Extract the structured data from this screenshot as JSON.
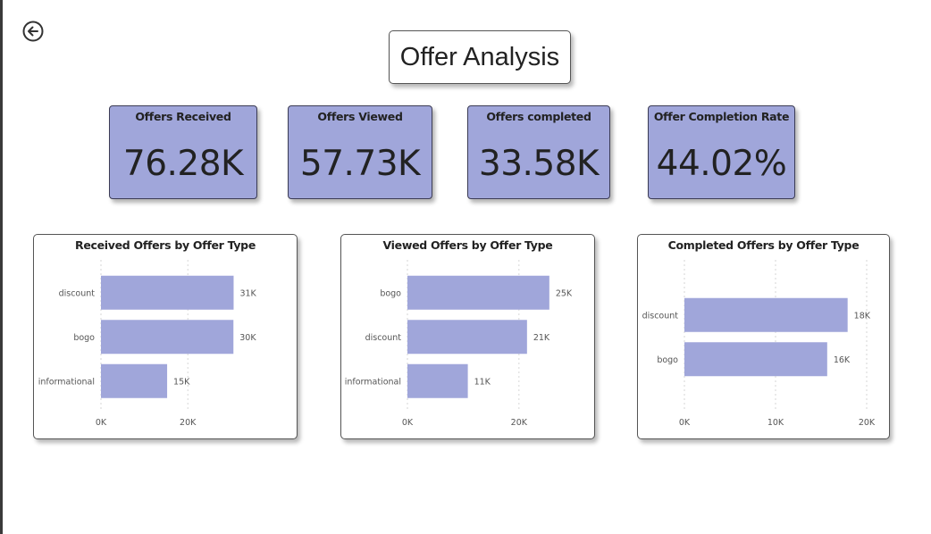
{
  "page": {
    "title": "Offer Analysis",
    "back_icon": "back-arrow-icon",
    "accent_color": "#a0a6da"
  },
  "cards": [
    {
      "label": "Offers Received",
      "value": "76.28K"
    },
    {
      "label": "Offers Viewed",
      "value": "57.73K"
    },
    {
      "label": "Offers completed",
      "value": "33.58K"
    },
    {
      "label": "Offer Completion Rate",
      "value": "44.02%"
    }
  ],
  "chart_data": [
    {
      "type": "bar",
      "orientation": "horizontal",
      "title": "Received Offers by Offer Type",
      "categories": [
        "discount",
        "bogo",
        "informational"
      ],
      "values": [
        30543,
        30499,
        15235
      ],
      "data_labels": [
        "31K",
        "30K",
        "15K"
      ],
      "xticks": [
        0,
        20000
      ],
      "xtick_labels": [
        "0K",
        "20K"
      ],
      "xlim": [
        0,
        36000
      ],
      "grid": true,
      "color": "#a0a6da"
    },
    {
      "type": "bar",
      "orientation": "horizontal",
      "title": "Viewed Offers by Offer Type",
      "categories": [
        "bogo",
        "discount",
        "informational"
      ],
      "values": [
        25449,
        21445,
        10831
      ],
      "data_labels": [
        "25K",
        "21K",
        "11K"
      ],
      "xticks": [
        0,
        20000
      ],
      "xtick_labels": [
        "0K",
        "20K"
      ],
      "xlim": [
        0,
        29000
      ],
      "grid": true,
      "color": "#a0a6da"
    },
    {
      "type": "bar",
      "orientation": "horizontal",
      "title": "Completed Offers by Offer Type",
      "categories": [
        "discount",
        "bogo"
      ],
      "values": [
        17910,
        15669
      ],
      "data_labels": [
        "18K",
        "16K"
      ],
      "xticks": [
        0,
        10000,
        20000
      ],
      "xtick_labels": [
        "0K",
        "10K",
        "20K"
      ],
      "xlim": [
        0,
        20000
      ],
      "grid": true,
      "color": "#a0a6da"
    }
  ]
}
